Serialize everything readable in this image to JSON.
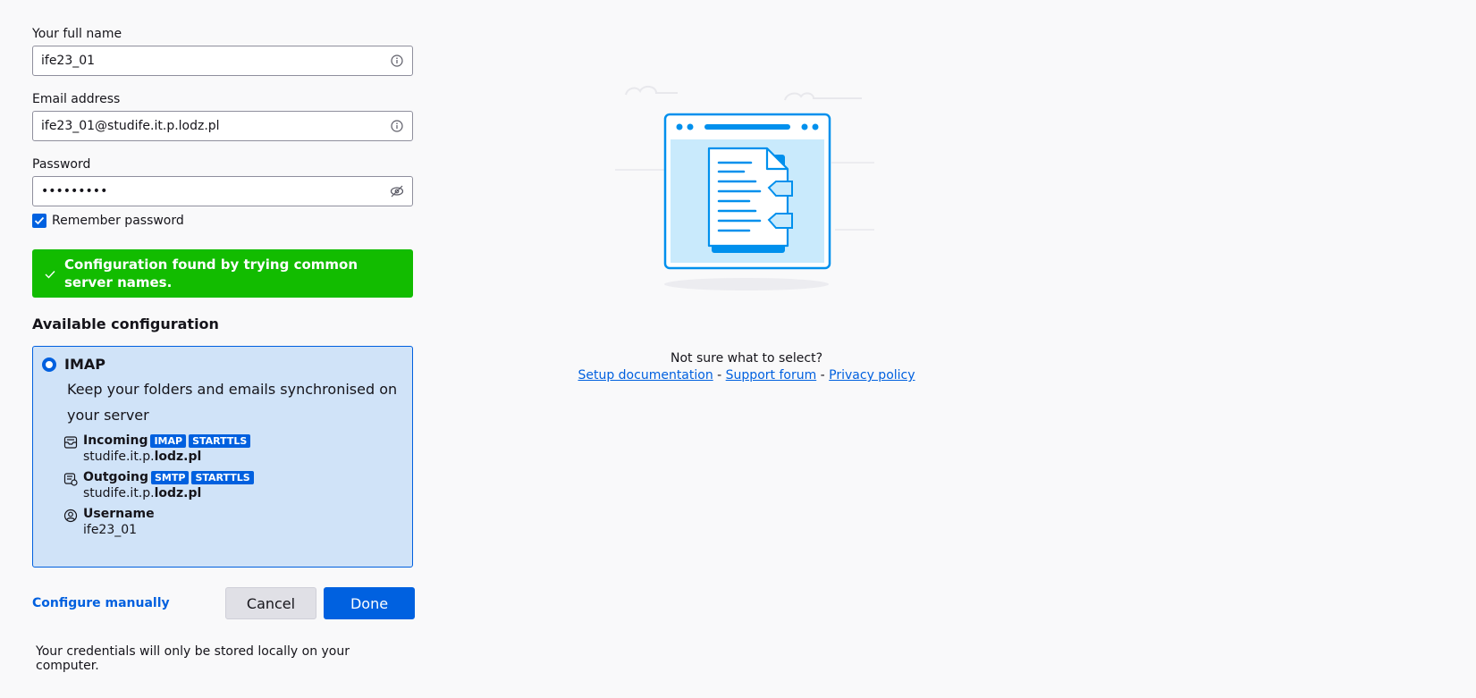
{
  "form": {
    "name_label": "Your full name",
    "name_value": "ife23_01",
    "email_label": "Email address",
    "email_value": "ife23_01@studife.it.p.lodz.pl",
    "password_label": "Password",
    "password_value": "ife23_01!",
    "remember_label": "Remember password",
    "remember_checked": true
  },
  "status": {
    "message": "Configuration found by trying common server names.",
    "color": "#12bc00"
  },
  "config": {
    "section_title": "Available configuration",
    "protocol": "IMAP",
    "description": "Keep your folders and emails synchronised on your server",
    "incoming": {
      "label": "Incoming",
      "tags": [
        "IMAP",
        "STARTTLS"
      ],
      "host_prefix": "studife.it.p.",
      "host_domain": "lodz.pl"
    },
    "outgoing": {
      "label": "Outgoing",
      "tags": [
        "SMTP",
        "STARTTLS"
      ],
      "host_prefix": "studife.it.p.",
      "host_domain": "lodz.pl"
    },
    "username": {
      "label": "Username",
      "value": "ife23_01"
    }
  },
  "actions": {
    "manual_label": "Configure manually",
    "cancel_label": "Cancel",
    "done_label": "Done"
  },
  "footer_note": "Your credentials will only be stored locally on your computer.",
  "help": {
    "question": "Not sure what to select?",
    "links": [
      "Setup documentation",
      "Support forum",
      "Privacy policy"
    ],
    "separator": " - "
  },
  "accent_color": "#0060df"
}
